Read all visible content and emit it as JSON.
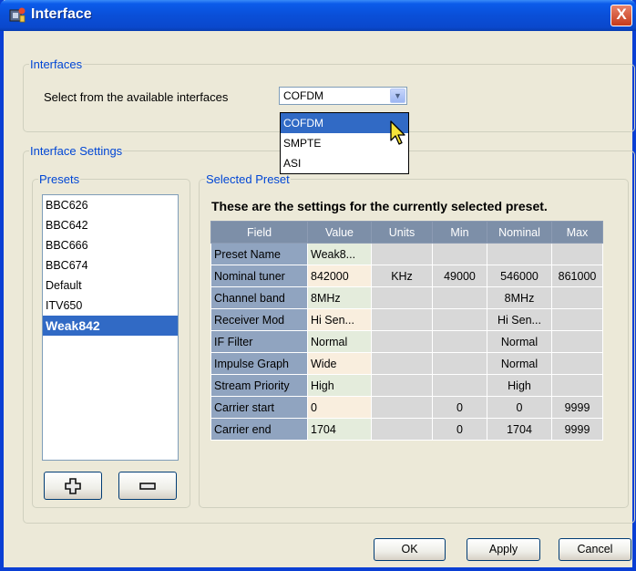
{
  "window": {
    "title": "Interface",
    "close_label": "X"
  },
  "interfaces_group": {
    "legend": "Interfaces",
    "select_label": "Select from the available interfaces",
    "selected_value": "COFDM",
    "options": [
      "COFDM",
      "SMPTE",
      "ASI"
    ]
  },
  "settings_group": {
    "legend": "Interface Settings"
  },
  "presets": {
    "legend": "Presets",
    "items": [
      "BBC626",
      "BBC642",
      "BBC666",
      "BBC674",
      "Default",
      "ITV650",
      "Weak842"
    ],
    "selected": "Weak842"
  },
  "selected_preset": {
    "legend": "Selected Preset",
    "heading": "These are the settings for the currently selected preset.",
    "columns": [
      "Field",
      "Value",
      "Units",
      "Min",
      "Nominal",
      "Max"
    ],
    "rows": [
      {
        "field": "Preset Name",
        "value": "Weak8...",
        "units": "",
        "min": "",
        "nominal": "",
        "max": ""
      },
      {
        "field": "Nominal tuner",
        "value": "842000",
        "units": "KHz",
        "min": "49000",
        "nominal": "546000",
        "max": "861000"
      },
      {
        "field": "Channel band",
        "value": "8MHz",
        "units": "",
        "min": "",
        "nominal": "8MHz",
        "max": ""
      },
      {
        "field": "Receiver Mod",
        "value": "Hi Sen...",
        "units": "",
        "min": "",
        "nominal": "Hi Sen...",
        "max": ""
      },
      {
        "field": "IF Filter",
        "value": "Normal",
        "units": "",
        "min": "",
        "nominal": "Normal",
        "max": ""
      },
      {
        "field": "Impulse Graph",
        "value": "Wide",
        "units": "",
        "min": "",
        "nominal": "Normal",
        "max": ""
      },
      {
        "field": "Stream Priority",
        "value": "High",
        "units": "",
        "min": "",
        "nominal": "High",
        "max": ""
      },
      {
        "field": "Carrier start",
        "value": "0",
        "units": "",
        "min": "0",
        "nominal": "0",
        "max": "9999"
      },
      {
        "field": "Carrier end",
        "value": "1704",
        "units": "",
        "min": "0",
        "nominal": "1704",
        "max": "9999"
      }
    ]
  },
  "buttons": {
    "add_icon": "plus-icon",
    "remove_icon": "minus-icon",
    "ok": "OK",
    "apply": "Apply",
    "cancel": "Cancel"
  },
  "colors": {
    "titlebar": "#0a4fd8",
    "selection": "#316ac5",
    "legend_text": "#0046d5",
    "dialog_bg": "#ece9d8"
  }
}
